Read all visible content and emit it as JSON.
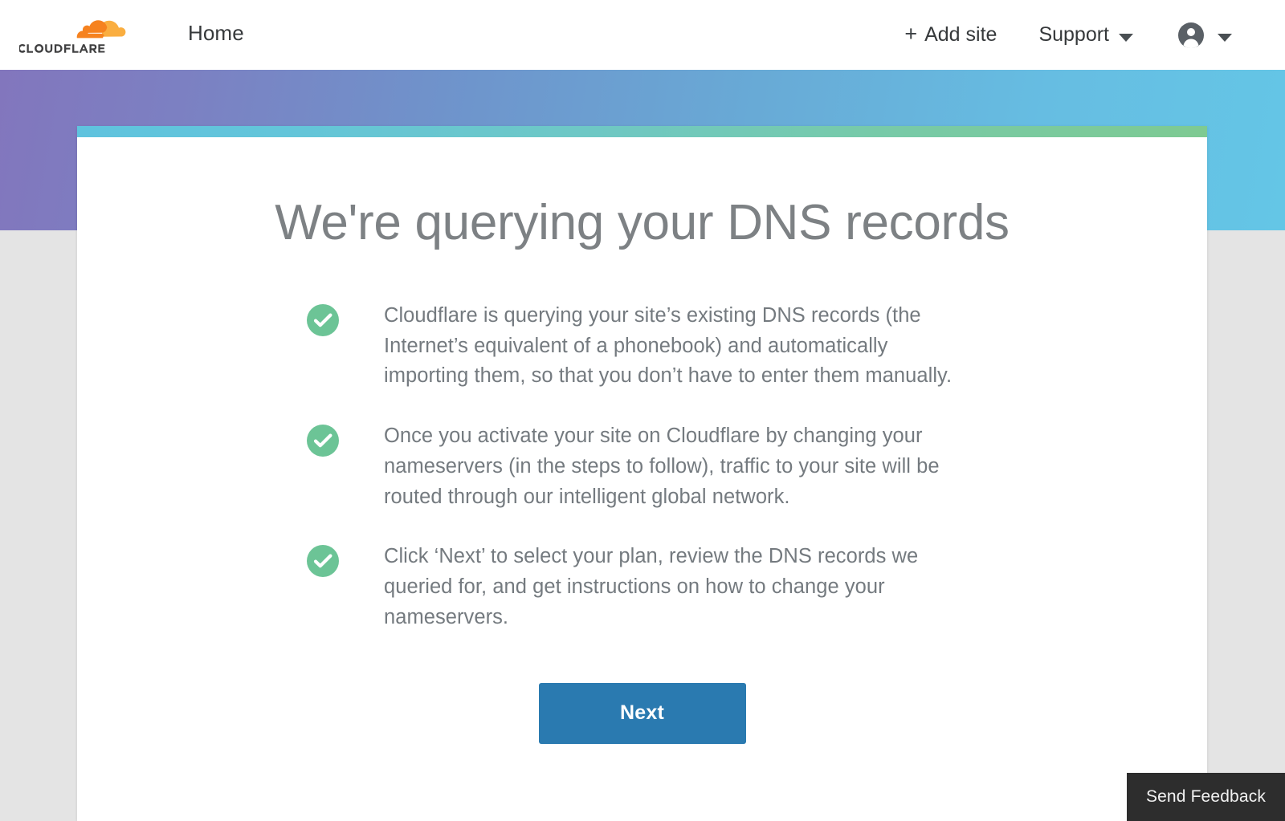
{
  "header": {
    "logo": {
      "icon": "cloudflare-cloud-logo",
      "wordmark": "CLOUDFLARE"
    },
    "home_label": "Home",
    "add_site_label": "Add site",
    "add_site_icon": "plus-icon",
    "support_label": "Support",
    "support_caret_icon": "chevron-down-icon",
    "account_icon": "user-avatar-icon",
    "account_caret_icon": "chevron-down-icon"
  },
  "card": {
    "title": "We're querying your DNS records",
    "bullets": [
      {
        "icon": "check-circle-icon",
        "text": "Cloudflare is querying your site’s existing DNS records (the Internet’s equivalent of a phonebook) and automatically importing them, so that you don’t have to enter them manually."
      },
      {
        "icon": "check-circle-icon",
        "text": "Once you activate your site on Cloudflare by changing your nameservers (in the steps to follow), traffic to your site will be routed through our intelligent global network."
      },
      {
        "icon": "check-circle-icon",
        "text": "Click ‘Next’ to select your plan, review the DNS records we queried for, and get instructions on how to change your nameservers."
      }
    ],
    "next_label": "Next"
  },
  "feedback": {
    "label": "Send Feedback"
  },
  "colors": {
    "brand_orange": "#f6821f",
    "brand_orange_light": "#faae40",
    "wordmark": "#404041",
    "hero_gradient_start": "#8276bd",
    "hero_gradient_end": "#64c6e6",
    "card_bar_start": "#5fc3de",
    "card_bar_end": "#7eca92",
    "check_green": "#6cc496",
    "primary_button": "#2a7ab0",
    "title_gray": "#7d8184",
    "body_gray": "#747a7f",
    "page_background": "#e4e4e4",
    "feedback_background": "#2d2d2d"
  }
}
